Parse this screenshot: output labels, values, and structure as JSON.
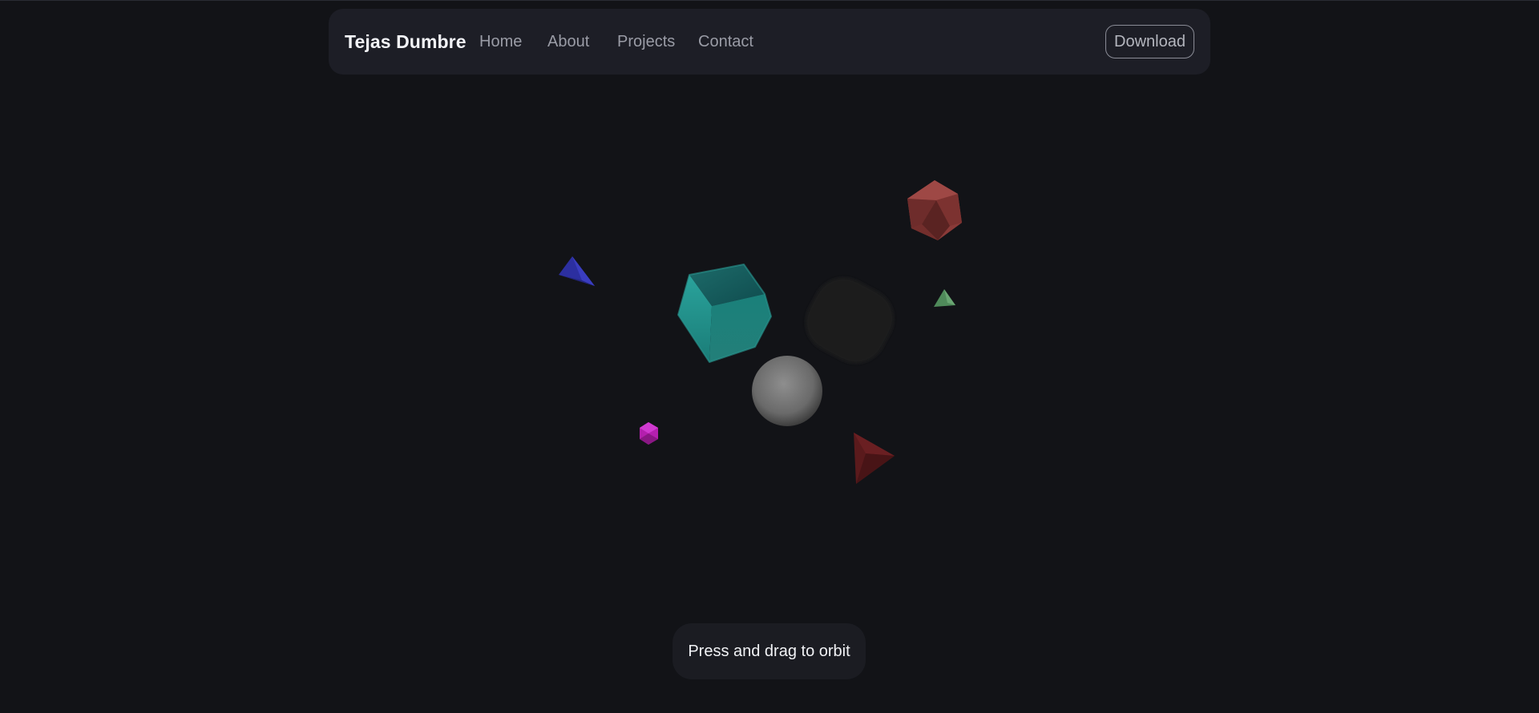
{
  "header": {
    "brand": "Tejas Dumbre",
    "nav": [
      {
        "label": "Home"
      },
      {
        "label": "About"
      },
      {
        "label": "Projects"
      },
      {
        "label": "Contact"
      }
    ],
    "download_label": "Download"
  },
  "scene": {
    "objects": [
      {
        "name": "teal-cube",
        "color": "#1f8a86"
      },
      {
        "name": "gray-sphere",
        "color": "#7a7a7a"
      },
      {
        "name": "dark-rounded-box",
        "color": "#1a1b1c"
      },
      {
        "name": "red-icosahedron",
        "color": "#8a3a38"
      },
      {
        "name": "blue-tetrahedron",
        "color": "#2c2fa0"
      },
      {
        "name": "green-tetrahedron",
        "color": "#4f8a5a"
      },
      {
        "name": "magenta-octahedron",
        "color": "#b41fae"
      },
      {
        "name": "dark-red-tetrahedron",
        "color": "#5a1a1c"
      }
    ]
  },
  "hint": {
    "label": "Press and drag to orbit"
  }
}
